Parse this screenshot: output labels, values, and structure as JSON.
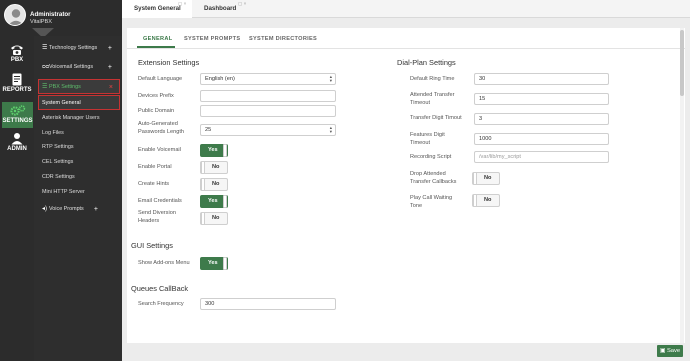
{
  "profile": {
    "name": "Administrator",
    "subtitle": "VitalPBX"
  },
  "rail": [
    {
      "label": "PBX",
      "icon": "phone-icon"
    },
    {
      "label": "REPORTS",
      "icon": "reports-icon"
    },
    {
      "label": "SETTINGS",
      "icon": "settings-gears-icon",
      "active": true
    },
    {
      "label": "ADMIN",
      "icon": "admin-user-icon"
    }
  ],
  "nav": {
    "technology": "Technology Settings",
    "voicemail": "Voicemail Settings",
    "pbx_settings": "PBX Settings",
    "system_general": "System General",
    "asterisk_users": "Asterisk Manager Users",
    "log_files": "Log Files",
    "rtp": "RTP Settings",
    "cel": "CEL Settings",
    "cdr": "CDR Settings",
    "http": "Mini HTTP Server",
    "voice_prompts": "Voice Prompts",
    "plus": "+",
    "close": "×"
  },
  "tabs": [
    {
      "label": "System General",
      "active": true
    },
    {
      "label": "Dashboard",
      "active": false
    }
  ],
  "tab_icons": "▢ ×",
  "subtabs": [
    "GENERAL",
    "SYSTEM PROMPTS",
    "SYSTEM DIRECTORIES"
  ],
  "extension": {
    "title": "Extension Settings",
    "default_language_label": "Default Language",
    "default_language_value": "English (en)",
    "devices_prefix_label": "Devices Prefix",
    "devices_prefix_value": "",
    "public_domain_label": "Public Domain",
    "public_domain_value": "",
    "autogen_label_1": "Auto-Generated",
    "autogen_label_2": "Passwords Length",
    "autogen_value": "25",
    "enable_voicemail_label": "Enable Voicemail",
    "enable_voicemail": "Yes",
    "enable_portal_label": "Enable Portal",
    "enable_portal": "No",
    "create_hints_label": "Create Hints",
    "create_hints": "No",
    "email_credentials_label": "Email Credentials",
    "email_credentials": "Yes",
    "send_diversion_label_1": "Send Diversion",
    "send_diversion_label_2": "Headers",
    "send_diversion": "No"
  },
  "dialplan": {
    "title": "Dial-Plan Settings",
    "default_ring_label": "Default Ring Time",
    "default_ring_value": "30",
    "attended_label_1": "Attended Transfer",
    "attended_label_2": "Timeout",
    "attended_value": "15",
    "digit_label": "Transfer Digit Timout",
    "digit_value": "3",
    "features_label_1": "Features Digit",
    "features_label_2": "Timeout",
    "features_value": "1000",
    "recording_label": "Recording Script",
    "recording_placeholder": "/var/lib/my_script",
    "drop_label_1": "Drop Attended",
    "drop_label_2": "Transfer Callbacks",
    "drop_value": "No",
    "play_label_1": "Play Call Waiting",
    "play_label_2": "Tone",
    "play_value": "No"
  },
  "gui": {
    "title": "GUI Settings",
    "addons_label": "Show Add-ons Menu",
    "addons_value": "Yes"
  },
  "queues": {
    "title": "Queues CallBack",
    "search_label": "Search Frequency",
    "search_value": "300"
  },
  "save_label": "Save",
  "colors": {
    "accent": "#3e7b4b",
    "highlight_border": "#c53333",
    "rail_bg": "#2c2c2c"
  }
}
